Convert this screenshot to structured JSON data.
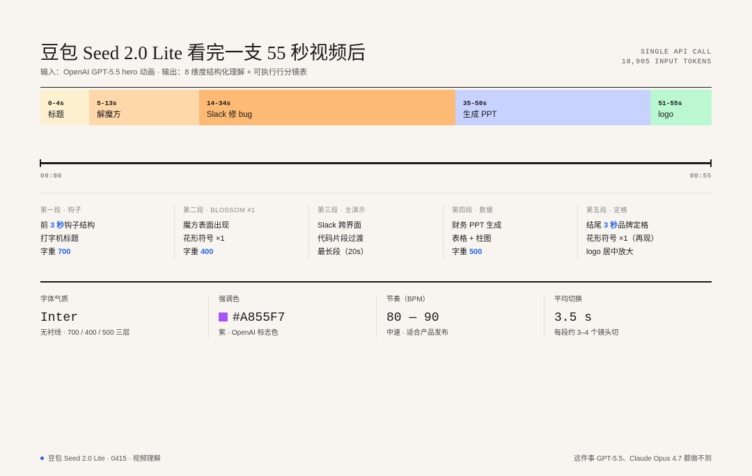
{
  "header": {
    "title": "豆包 Seed 2.0 Lite 看完一支 55 秒视频后",
    "subtitle": "输入：OpenAI GPT-5.5 hero 动画 · 输出：8 维度结构化理解 + 可执行行分镜表",
    "meta": [
      "SINGLE API CALL",
      "18,905 INPUT TOKENS"
    ]
  },
  "timeline": {
    "segments": [
      {
        "range": "0-4s",
        "label": "标题",
        "start": 0,
        "end": 4,
        "color": "#fdf0cf"
      },
      {
        "range": "5-13s",
        "label": "解魔方",
        "start": 4,
        "end": 13,
        "color": "#fed7aa"
      },
      {
        "range": "14-34s",
        "label": "Slack 修 bug",
        "start": 13,
        "end": 34,
        "color": "#fdba74"
      },
      {
        "range": "35-50s",
        "label": "生成 PPT",
        "start": 34,
        "end": 50,
        "color": "#c7d2fe"
      },
      {
        "range": "51-55s",
        "label": "logo",
        "start": 50,
        "end": 55,
        "color": "#bbf7d0"
      }
    ],
    "start_time": "00:00",
    "end_time": "00:55"
  },
  "phases": [
    {
      "title": "第一段 · 钩子",
      "lines": [
        [
          {
            "t": "前 "
          },
          {
            "t": "3 秒",
            "a": true
          },
          {
            "t": "钩子结构"
          }
        ],
        [
          {
            "t": "打字机标题"
          }
        ],
        [
          {
            "t": "字重 "
          },
          {
            "t": "700",
            "a": true
          }
        ]
      ]
    },
    {
      "title": "第二段 · BLOSSOM #1",
      "lines": [
        [
          {
            "t": "魔方表面出现"
          }
        ],
        [
          {
            "t": "花形符号 ×1"
          }
        ],
        [
          {
            "t": "字重 "
          },
          {
            "t": "400",
            "a": true
          }
        ]
      ]
    },
    {
      "title": "第三段 · 主演示",
      "lines": [
        [
          {
            "t": "Slack 跨界面"
          }
        ],
        [
          {
            "t": "代码片段过渡"
          }
        ],
        [
          {
            "t": "最长段（20s）"
          }
        ]
      ]
    },
    {
      "title": "第四段 · 数据",
      "lines": [
        [
          {
            "t": "财务 PPT 生成"
          }
        ],
        [
          {
            "t": "表格 + 柱图"
          }
        ],
        [
          {
            "t": "字重 "
          },
          {
            "t": "500",
            "a": true
          }
        ]
      ]
    },
    {
      "title": "第五段 · 定格",
      "lines": [
        [
          {
            "t": "结尾 "
          },
          {
            "t": "3 秒",
            "a": true
          },
          {
            "t": "品牌定格"
          }
        ],
        [
          {
            "t": "花形符号 ×1（再现）"
          }
        ],
        [
          {
            "t": "logo 居中放大"
          }
        ]
      ]
    }
  ],
  "stats": [
    {
      "label": "字体气质",
      "value": "Inter",
      "note": "无衬线 · 700 / 400 / 500 三层"
    },
    {
      "label": "强调色",
      "value": "#A855F7",
      "note": "紫 · OpenAI 标志色",
      "swatch": "#a855f7"
    },
    {
      "label": "节奏（BPM）",
      "value": "80 — 90",
      "note": "中速 · 适合产品发布"
    },
    {
      "label": "平均切换",
      "value": "3.5 s",
      "note": "每段约 3–4 个镜头切"
    }
  ],
  "footer": {
    "left": "豆包 Seed 2.0 Lite · 0415 · 视频理解",
    "right": "这件事 GPT-5.5、Claude Opus 4.7 都做不到",
    "dot_color": "#2563eb"
  },
  "colors": {
    "accent": "#2563eb",
    "rule": "#1a1a1a",
    "background": "#f8f5f0"
  }
}
